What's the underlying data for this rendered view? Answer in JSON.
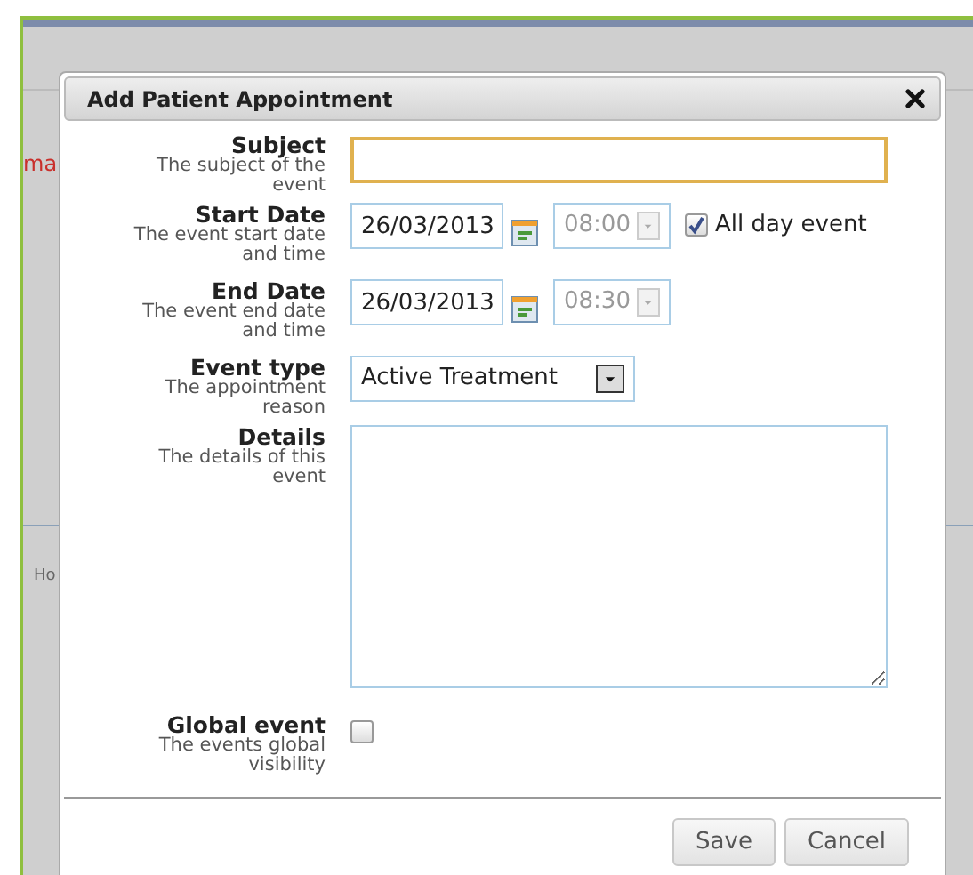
{
  "background": {
    "link_fragment": "ma",
    "label_fragment": "Ho"
  },
  "dialog": {
    "title": "Add Patient Appointment",
    "fields": [
      {
        "kind": "text",
        "label": "Subject",
        "hint": "The subject of the event",
        "focused": true
      },
      {
        "kind": "datetime",
        "label": "Start Date",
        "hint": "The event start date and time",
        "date": "26/03/2013",
        "time": "08:00",
        "time_disabled": true,
        "all_day": {
          "label": "All day event",
          "checked": true
        }
      },
      {
        "kind": "datetime",
        "label": "End Date",
        "hint": "The event end date and time",
        "date": "26/03/2013",
        "time": "08:30",
        "time_disabled": true
      },
      {
        "kind": "select",
        "label": "Event type",
        "hint": "The appointment reason",
        "value": "Active Treatment"
      },
      {
        "kind": "textarea",
        "label": "Details",
        "hint": "The details of this event"
      },
      {
        "kind": "checkbox",
        "label": "Global event",
        "hint": "The events global visibility",
        "checked": false
      }
    ],
    "buttons": [
      "Save",
      "Cancel"
    ]
  }
}
